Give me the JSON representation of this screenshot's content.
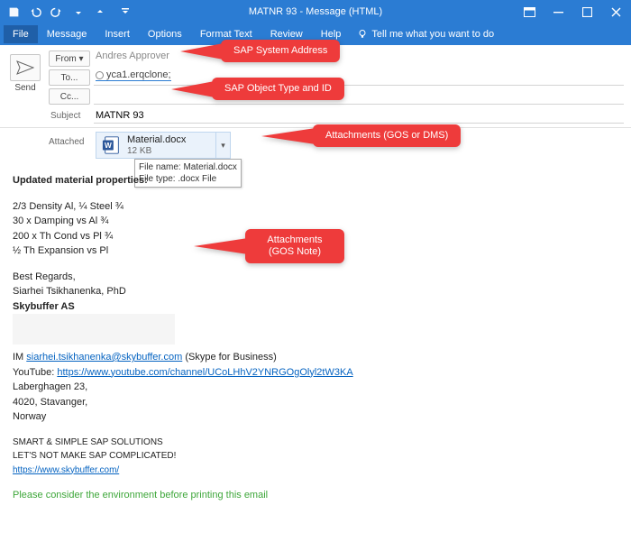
{
  "window": {
    "title": "MATNR 93  -  Message (HTML)"
  },
  "tabs": {
    "file": "File",
    "message": "Message",
    "insert": "Insert",
    "options": "Options",
    "format": "Format Text",
    "review": "Review",
    "help": "Help",
    "tellme": "Tell me what you want to do"
  },
  "send": {
    "label": "Send"
  },
  "fields": {
    "from_label": "From",
    "from_value": "Andres Approver",
    "to_label": "To...",
    "to_value": "yca1.erqclone;",
    "cc_label": "Cc...",
    "cc_value": "",
    "subject_label": "Subject",
    "subject_value": "MATNR 93"
  },
  "attachment": {
    "label": "Attached",
    "name": "Material.docx",
    "size": "12 KB",
    "tooltip_l1": "File name:  Material.docx",
    "tooltip_l2": "File type:  .docx File"
  },
  "body": {
    "heading": "Updated material properties:",
    "l1": "2/3 Density Al, ¼ Steel ¾",
    "l2": "30 x Damping vs Al ¾",
    "l3": "200 x Th Cond vs Pl ¾",
    "l4": "½ Th Expansion vs Pl",
    "regards": "Best Regards,",
    "name": "Siarhei Tsikhanenka, PhD",
    "company": "Skybuffer AS",
    "im_prefix": "IM ",
    "im_link": "siarhei.tsikhanenka@skybuffer.com",
    "im_suffix": " (Skype for Business)",
    "yt_prefix": "YouTube: ",
    "yt_link": "https://www.youtube.com/channel/UCoLHhV2YNRGOgOlyl2tW3KA",
    "addr1": "Laberghagen 23,",
    "addr2": "4020, Stavanger,",
    "addr3": "Norway",
    "tag1": "SMART & SIMPLE SAP SOLUTIONS",
    "tag2": "LET'S NOT MAKE SAP COMPLICATED!",
    "site": "https://www.skybuffer.com/",
    "env": "Please consider the environment before printing this email"
  },
  "callouts": {
    "c1": "SAP System Address",
    "c2": "SAP Object Type and ID",
    "c3": "Attachments (GOS or DMS)",
    "c4": "Attachments (GOS Note)"
  },
  "colors": {
    "accent": "#2b7cd3",
    "callout": "#ee3b3b",
    "link": "#0563c1",
    "env": "#3da639"
  }
}
